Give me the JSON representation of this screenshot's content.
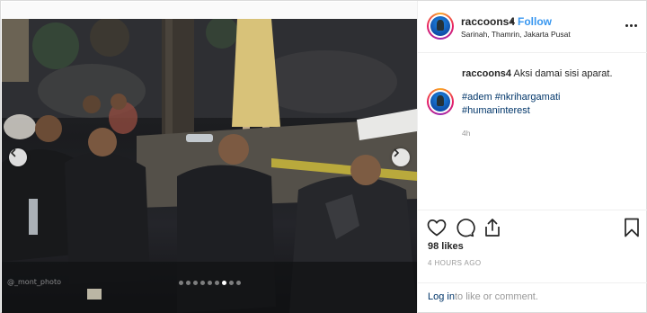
{
  "post": {
    "user": {
      "username": "raccoons4",
      "separator": "•",
      "follow_label": "Follow",
      "location": "Sarinah, Thamrin, Jakarta Pusat"
    },
    "caption": {
      "username": "raccoons4",
      "text": "Aksi damai sisi aparat."
    },
    "hashtags": [
      "#adem #nkrihargamati",
      "#humaninterest"
    ],
    "caption_time": "4h",
    "likes": "98 likes",
    "posted_time": "4 HOURS AGO",
    "login": {
      "link_label": "Log in",
      "rest_text": "to like or comment."
    },
    "photo": {
      "watermark": "@_mont_photo",
      "carousel_total": 9,
      "carousel_active": 7
    }
  },
  "icons": {
    "more": "more-options-icon",
    "prev": "chevron-left-icon",
    "next": "chevron-right-icon",
    "like": "heart-icon",
    "comment": "comment-icon",
    "share": "share-icon",
    "save": "bookmark-icon"
  },
  "colors": {
    "follow": "#3897f0",
    "link": "#003569",
    "muted": "#999999",
    "border": "#dbdbdb"
  }
}
